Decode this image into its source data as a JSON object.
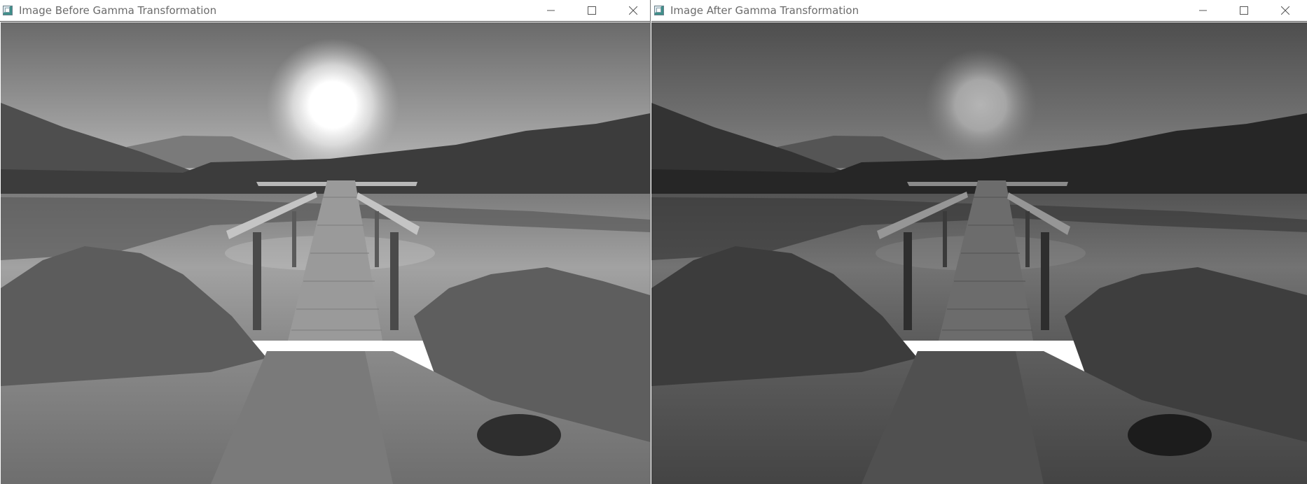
{
  "windows": [
    {
      "title": "Image Before Gamma Transformation",
      "image_description_icon": "image-window-icon"
    },
    {
      "title": "Image After Gamma Transformation",
      "image_description_icon": "image-window-icon"
    }
  ],
  "controls": {
    "minimize_icon": "minimize-icon",
    "maximize_icon": "maximize-icon",
    "close_icon": "close-icon"
  }
}
